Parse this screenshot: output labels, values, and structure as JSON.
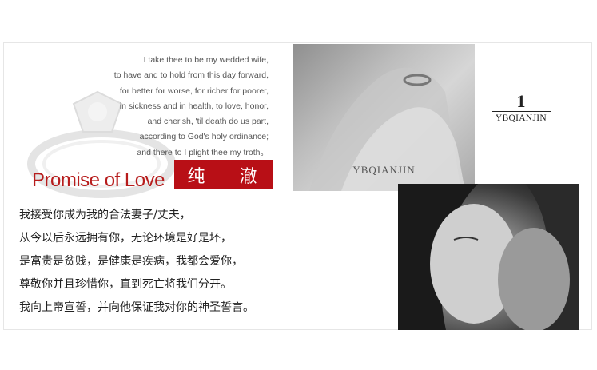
{
  "vows_en": [
    "I take thee to be my wedded wife,",
    "to have and to hold from this day forward,",
    "for better for worse, for richer for poorer,",
    "in sickness and in health, to love, honor,",
    "and cherish, 'til death do us part,",
    "according to God's holy ordinance;",
    "and there to I plight thee my troth。"
  ],
  "promise_title": "Promise of Love",
  "badge_text": "纯 澈",
  "vows_cn": [
    "我接受你成为我的合法妻子/丈夫，",
    "从今以后永远拥有你，无论环境是好是坏，",
    "是富贵是贫贱，是健康是疾病，我都会爱你，",
    "尊敬你并且珍惜你，直到死亡将我们分开。",
    "我向上帝宣誓，并向他保证我对你的神圣誓言。"
  ],
  "watermark": "YBQIANJIN",
  "section_number": "1",
  "brand": "YBQIANJIN",
  "colors": {
    "accent": "#b80f16",
    "title_red": "#b71c1c"
  }
}
